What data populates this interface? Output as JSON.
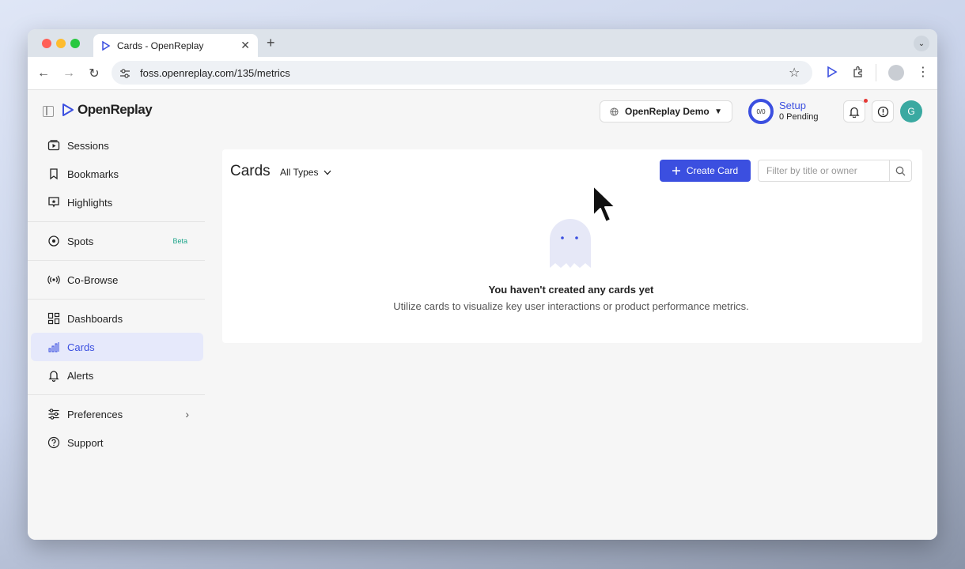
{
  "browser": {
    "tab_title": "Cards - OpenReplay",
    "tab_close": "✕",
    "new_tab": "+",
    "url": "foss.openreplay.com/135/metrics"
  },
  "header": {
    "logo_text": "OpenReplay",
    "project_name": "OpenReplay Demo",
    "setup_progress": "0/0",
    "setup_title": "Setup",
    "setup_pending": "0 Pending",
    "avatar_initial": "G"
  },
  "sidebar": {
    "items": [
      {
        "label": "Sessions"
      },
      {
        "label": "Bookmarks"
      },
      {
        "label": "Highlights"
      },
      {
        "label": "Spots",
        "badge": "Beta"
      },
      {
        "label": "Co-Browse"
      },
      {
        "label": "Dashboards"
      },
      {
        "label": "Cards"
      },
      {
        "label": "Alerts"
      },
      {
        "label": "Preferences"
      },
      {
        "label": "Support"
      }
    ]
  },
  "main": {
    "title": "Cards",
    "type_filter": "All Types",
    "create_button": "Create Card",
    "search_placeholder": "Filter by title or owner",
    "empty_title": "You haven't created any cards yet",
    "empty_subtitle": "Utilize cards to visualize key user interactions or product performance metrics."
  },
  "colors": {
    "accent": "#3b4fe0",
    "active_bg": "#e6e9fb",
    "avatar": "#3aa9a1",
    "beta": "#1fa68b"
  }
}
